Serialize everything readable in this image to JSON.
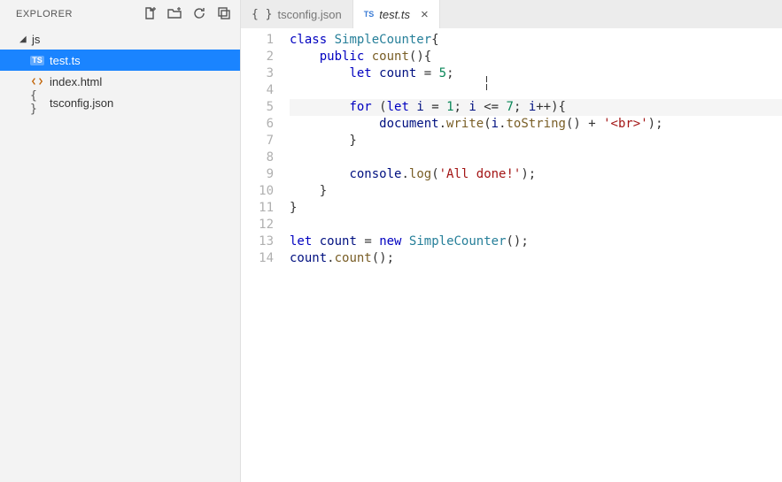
{
  "sidebar": {
    "title": "EXPLORER",
    "folder": "js",
    "files": [
      {
        "name": "test.ts",
        "selected": true,
        "iconType": "ts"
      },
      {
        "name": "index.html",
        "selected": false,
        "iconType": "html"
      },
      {
        "name": "tsconfig.json",
        "selected": false,
        "iconType": "json"
      }
    ],
    "actionIcons": [
      "new-file-icon",
      "new-folder-icon",
      "refresh-icon",
      "collapse-all-icon"
    ]
  },
  "tabs": [
    {
      "label": "tsconfig.json",
      "active": false,
      "iconType": "json",
      "closeable": false
    },
    {
      "label": "test.ts",
      "active": true,
      "iconType": "ts",
      "closeable": true
    }
  ],
  "editor": {
    "highlighted_line_index": 4,
    "lines": [
      [
        [
          "kw",
          "class"
        ],
        [
          "op",
          " "
        ],
        [
          "typ",
          "SimpleCounter"
        ],
        [
          "op",
          "{"
        ]
      ],
      [
        [
          "op",
          "    "
        ],
        [
          "kw",
          "public"
        ],
        [
          "op",
          " "
        ],
        [
          "fn",
          "count"
        ],
        [
          "op",
          "(){"
        ]
      ],
      [
        [
          "op",
          "        "
        ],
        [
          "kw",
          "let"
        ],
        [
          "op",
          " "
        ],
        [
          "id",
          "count"
        ],
        [
          "op",
          " = "
        ],
        [
          "num",
          "5"
        ],
        [
          "op",
          ";"
        ]
      ],
      [],
      [
        [
          "op",
          "        "
        ],
        [
          "kw",
          "for"
        ],
        [
          "op",
          " ("
        ],
        [
          "kw",
          "let"
        ],
        [
          "op",
          " "
        ],
        [
          "id",
          "i"
        ],
        [
          "op",
          " = "
        ],
        [
          "num",
          "1"
        ],
        [
          "op",
          "; "
        ],
        [
          "id",
          "i"
        ],
        [
          "op",
          " <= "
        ],
        [
          "num",
          "7"
        ],
        [
          "op",
          "; "
        ],
        [
          "id",
          "i"
        ],
        [
          "op",
          "++){"
        ]
      ],
      [
        [
          "op",
          "            "
        ],
        [
          "id",
          "document"
        ],
        [
          "op",
          "."
        ],
        [
          "fn",
          "write"
        ],
        [
          "op",
          "("
        ],
        [
          "id",
          "i"
        ],
        [
          "op",
          "."
        ],
        [
          "fn",
          "toString"
        ],
        [
          "op",
          "() + "
        ],
        [
          "str",
          "'<br>'"
        ],
        [
          "op",
          ");"
        ]
      ],
      [
        [
          "op",
          "        }"
        ]
      ],
      [],
      [
        [
          "op",
          "        "
        ],
        [
          "id",
          "console"
        ],
        [
          "op",
          "."
        ],
        [
          "fn",
          "log"
        ],
        [
          "op",
          "("
        ],
        [
          "str",
          "'All done!'"
        ],
        [
          "op",
          ");"
        ]
      ],
      [
        [
          "op",
          "    }"
        ]
      ],
      [
        [
          "op",
          "}"
        ]
      ],
      [],
      [
        [
          "kw",
          "let"
        ],
        [
          "op",
          " "
        ],
        [
          "id",
          "count"
        ],
        [
          "op",
          " = "
        ],
        [
          "kw",
          "new"
        ],
        [
          "op",
          " "
        ],
        [
          "typ",
          "SimpleCounter"
        ],
        [
          "op",
          "();"
        ]
      ],
      [
        [
          "id",
          "count"
        ],
        [
          "op",
          "."
        ],
        [
          "fn",
          "count"
        ],
        [
          "op",
          "();"
        ]
      ]
    ]
  }
}
